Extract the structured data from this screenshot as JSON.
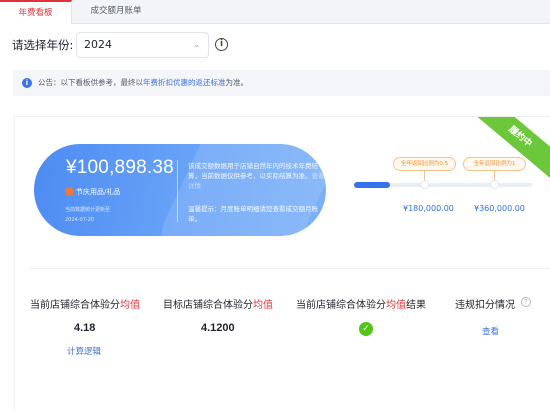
{
  "tabs": [
    {
      "label": "年费看板",
      "active": true
    },
    {
      "label": "成交额月账单",
      "active": false
    }
  ],
  "year_filter": {
    "label": "请选择年份:",
    "value": "2024"
  },
  "notice": {
    "prefix": "公告：以下看板供参考，最终以",
    "highlight": "年费折扣优惠的返还标准",
    "suffix": "为准。"
  },
  "status_ribbon": "履约中",
  "summary_card": {
    "amount": "¥100,898.38",
    "category": "节庆用品/礼品",
    "sub_line_1": "当前数据统计更新至",
    "sub_line_2": "2024-07-20",
    "note": "该成交额数据用于店铺自然年内的技术年费结算，当前数据仅供参考，以实际结算为准。",
    "note_link": "查看详情",
    "tip": "温馨提示：月度账单明细请您查看成交额月账单。"
  },
  "progress": {
    "current_fraction": 0.2,
    "tiers": [
      {
        "label": "全年返回比例为0.5",
        "amount": "¥180,000.00"
      },
      {
        "label": "全年返回比例为1",
        "amount": "¥360,000.00"
      }
    ]
  },
  "metrics": [
    {
      "label_pre": "当前店铺综合体验分",
      "label_red": "均值",
      "label_post": "",
      "value": "4.18",
      "link": "计算逻辑"
    },
    {
      "label_pre": "目标店铺综合体验分",
      "label_red": "均值",
      "label_post": "",
      "value": "4.1200"
    },
    {
      "label_pre": "当前店铺综合体验分",
      "label_red": "均值",
      "label_post": "结果",
      "value_icon": "check-circle-icon"
    },
    {
      "label_pre": "违规扣分情况",
      "link": "查看"
    }
  ],
  "colors": {
    "brand_red": "#e0343a",
    "brand_blue": "#3472ec",
    "success_green": "#52c41a",
    "tier_orange": "#f0902e"
  }
}
